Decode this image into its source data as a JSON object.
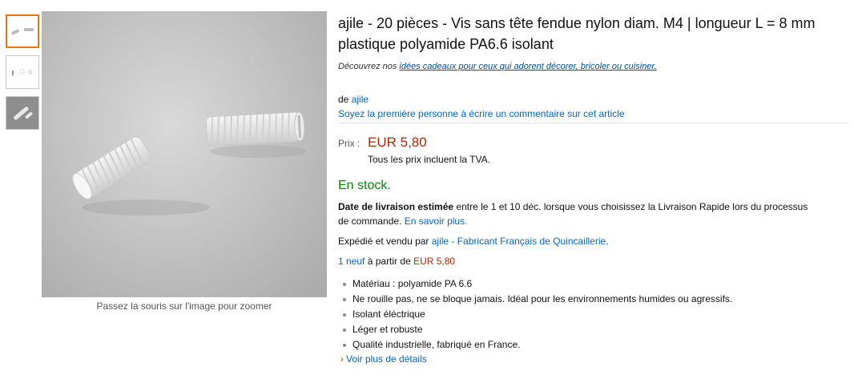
{
  "gallery": {
    "thumbnails": [
      {
        "name": "thumb-1",
        "selected": true
      },
      {
        "name": "thumb-2",
        "selected": false
      },
      {
        "name": "thumb-3",
        "selected": false
      }
    ],
    "zoom_hint": "Passez la souris sur l'image pour zoomer"
  },
  "product": {
    "title": "ajile - 20 pièces - Vis sans tête fendue nylon diam. M4 | longueur L = 8 mm plastique polyamide PA6.6 isolant",
    "promo_prefix": "Découvrez nos ",
    "promo_link": "idées cadeaux pour ceux qui adorent décorer, bricoler ou cuisiner.",
    "by_prefix": "de ",
    "brand": "ajile",
    "review_cta": "Soyez la première personne à écrire un commentaire sur cet article"
  },
  "price": {
    "label": "Prix :",
    "value": "EUR 5,80",
    "vat_note": "Tous les prix incluent la TVA."
  },
  "availability": {
    "stock": "En stock.",
    "delivery_label": "Date de livraison estimée",
    "delivery_text": " entre le 1 et 10 déc. lorsque vous choisissez la Livraison Rapide lors du processus de commande. ",
    "delivery_link": "En savoir plus.",
    "seller_prefix": "Expédié et vendu par ",
    "seller_link": "ajile - Fabricant Français de Quincaillerie",
    "seller_suffix": ".",
    "offers_link": "1 neuf",
    "offers_text": " à partir de ",
    "offers_price": "EUR 5,80"
  },
  "features": [
    "Matériau : polyamide PA 6.6",
    "Ne rouille pas, ne se bloque jamais. Idéal pour les environnements humides ou agressifs.",
    "Isolant éléctrique",
    "Léger et robuste",
    "Qualité industrielle, fabriqué en France."
  ],
  "more_details": "Voir plus de détails",
  "colors": {
    "link": "#0066c0",
    "price": "#b12704",
    "stock": "#008a00",
    "accent": "#e47911"
  }
}
